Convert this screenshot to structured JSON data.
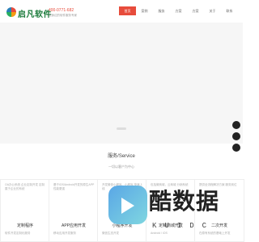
{
  "header": {
    "logo_text": "启凡软件",
    "phone": "400-0771-682",
    "slogan": "您身边的软件服务专家"
  },
  "nav": {
    "items": [
      "首页",
      "案例",
      "服务",
      "方案",
      "方案",
      "关于",
      "联系"
    ]
  },
  "section": {
    "title": "服务/Service",
    "subtitle": "一切以客户为中心"
  },
  "cards": [
    {
      "text": "OA办公系统 企业定制开发 定制属于企业的系统",
      "title": "定制程序",
      "tail": "软件开发定制化服务"
    },
    {
      "text": "基于iOS/Android开发的原生APP 性能更强",
      "title": "APP应用开发",
      "tail": "移动应用开发服务"
    },
    {
      "text": "开发微信小程序、小程序 快速上线",
      "title": "小程序开发",
      "tail": "微信生态开发"
    },
    {
      "text": "包括微商城，云商城 分销系统",
      "title": "定制商城开发",
      "tail": "Android / iOS"
    },
    {
      "text": "提供全流程解决方案 服务到位",
      "title": "二次开发",
      "tail": "在原有系统的基础上开发"
    }
  ],
  "watermark": {
    "text": "酷数据",
    "sub": "KUIDC"
  }
}
